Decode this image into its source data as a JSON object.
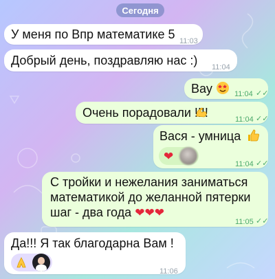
{
  "date_divider": "Сегодня",
  "messages": [
    {
      "text": "У меня по Впр математике 5",
      "time": "11:03",
      "direction": "incoming"
    },
    {
      "text": "Добрый день, поздравляю нас :)",
      "time": "11:04",
      "direction": "incoming"
    },
    {
      "text": "Вау",
      "emoji": "star-struck-emoji",
      "time": "11:04",
      "direction": "outgoing"
    },
    {
      "text": "Очень порадовали !!!!",
      "emoji": "flexed-biceps-emoji",
      "time": "11:04",
      "direction": "outgoing"
    },
    {
      "text": "Вася - умница",
      "emoji": "thumbs-up-emoji",
      "reaction": "heart",
      "time": "11:04",
      "direction": "outgoing"
    },
    {
      "lines": [
        "С тройки и нежелания заниматься",
        "математикой до желанной пятерки",
        "шаг - два года"
      ],
      "emoji": "three-hearts",
      "time": "11:05",
      "direction": "outgoing"
    },
    {
      "text": "Да!!! Я так благодарна Вам !",
      "time": "11:06",
      "direction": "incoming",
      "reaction": "folded-hands"
    }
  ],
  "colors": {
    "incoming_bubble": "#ffffff",
    "outgoing_bubble": "#ebffdc",
    "read_check": "#4ba96b",
    "heart": "#e4263a"
  }
}
